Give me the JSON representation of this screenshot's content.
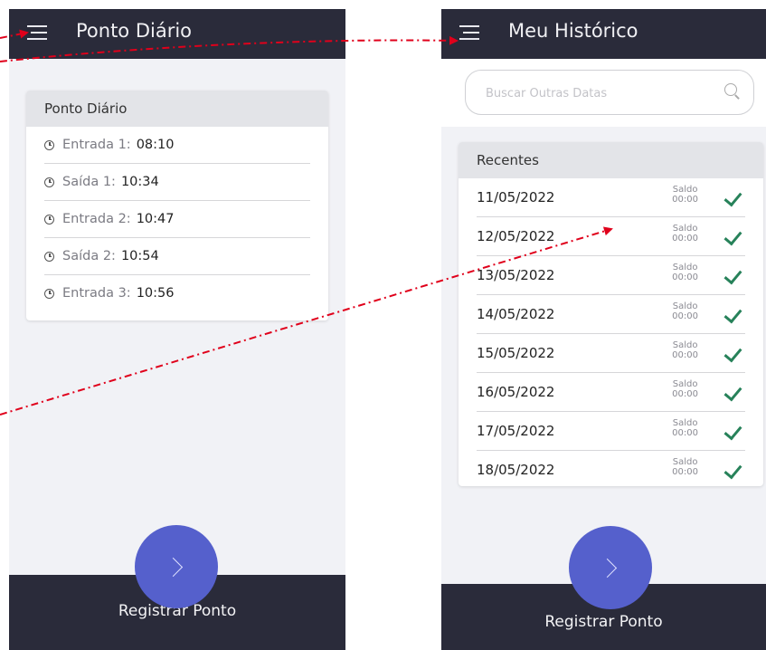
{
  "left_screen": {
    "appbar": {
      "title": "Ponto Diário"
    },
    "card": {
      "title": "Ponto Diário",
      "punches": [
        {
          "label": "Entrada 1:",
          "time": "08:10"
        },
        {
          "label": "Saída 1:",
          "time": "10:34"
        },
        {
          "label": "Entrada 2:",
          "time": "10:47"
        },
        {
          "label": "Saída 2:",
          "time": "10:54"
        },
        {
          "label": "Entrada 3:",
          "time": "10:56"
        }
      ]
    },
    "register_label": "Registrar Ponto"
  },
  "right_screen": {
    "appbar": {
      "title": "Meu Histórico"
    },
    "search": {
      "placeholder": "Buscar Outras Datas"
    },
    "card": {
      "title": "Recentes",
      "items": [
        {
          "date": "11/05/2022",
          "saldo_label": "Saldo",
          "saldo": "00:00"
        },
        {
          "date": "12/05/2022",
          "saldo_label": "Saldo",
          "saldo": "00:00"
        },
        {
          "date": "13/05/2022",
          "saldo_label": "Saldo",
          "saldo": "00:00"
        },
        {
          "date": "14/05/2022",
          "saldo_label": "Saldo",
          "saldo": "00:00"
        },
        {
          "date": "15/05/2022",
          "saldo_label": "Saldo",
          "saldo": "00:00"
        },
        {
          "date": "16/05/2022",
          "saldo_label": "Saldo",
          "saldo": "00:00"
        },
        {
          "date": "17/05/2022",
          "saldo_label": "Saldo",
          "saldo": "00:00"
        },
        {
          "date": "18/05/2022",
          "saldo_label": "Saldo",
          "saldo": "00:00"
        }
      ]
    },
    "register_label": "Registrar Ponto"
  },
  "colors": {
    "appbar": "#2a2b3a",
    "fab": "#5560cc",
    "check": "#27825a",
    "annotation_arrow": "#e0001b"
  }
}
